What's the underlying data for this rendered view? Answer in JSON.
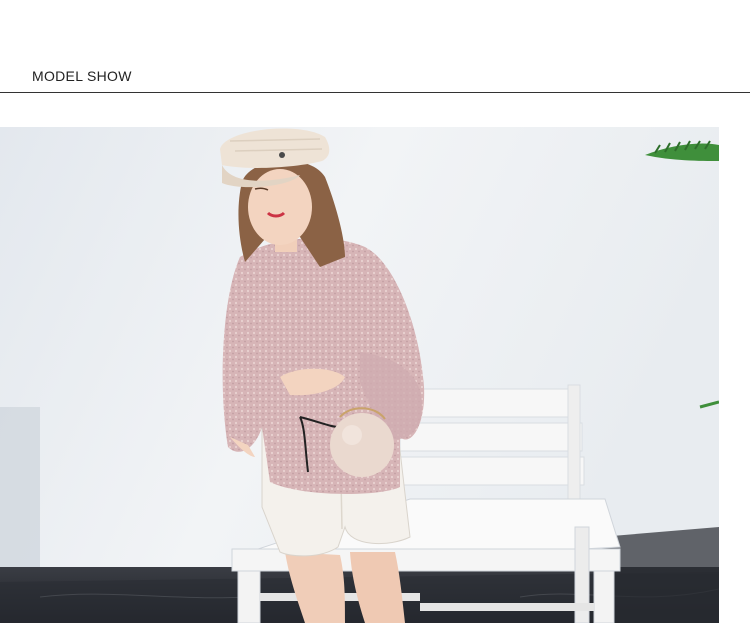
{
  "section": {
    "title": "MODEL SHOW"
  },
  "photo": {
    "subject": "model-show-photo",
    "colors": {
      "wall": "#eef1f4",
      "floor": "#2a2d33",
      "sweater": "#d9b8b9",
      "shorts": "#f4f1ec",
      "bench": "#f7f7f7",
      "cap": "#eee3d6",
      "hair": "#8b6245",
      "skin": "#f3d4c0",
      "bag": "#ead9cf",
      "plant": "#3f8f3b"
    }
  }
}
